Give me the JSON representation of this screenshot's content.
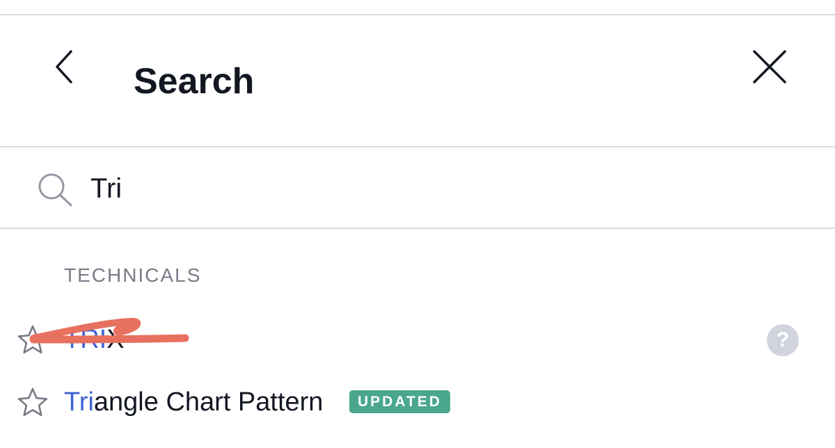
{
  "header": {
    "title": "Search",
    "back_icon": "chevron-left-icon",
    "close_icon": "close-icon"
  },
  "search": {
    "value": "Tri",
    "icon": "search-icon"
  },
  "section": {
    "title": "TECHNICALS"
  },
  "results": [
    {
      "match": "TRI",
      "rest": "X",
      "icon": "star-icon",
      "help_icon": "question-mark-icon",
      "help_glyph": "?"
    },
    {
      "match": "Tri",
      "rest": "angle Chart Pattern",
      "icon": "star-icon",
      "badge": "UPDATED"
    }
  ],
  "colors": {
    "highlight": "#3e62d6",
    "badge": "#4aa78d",
    "redaction": "#e8705f"
  }
}
